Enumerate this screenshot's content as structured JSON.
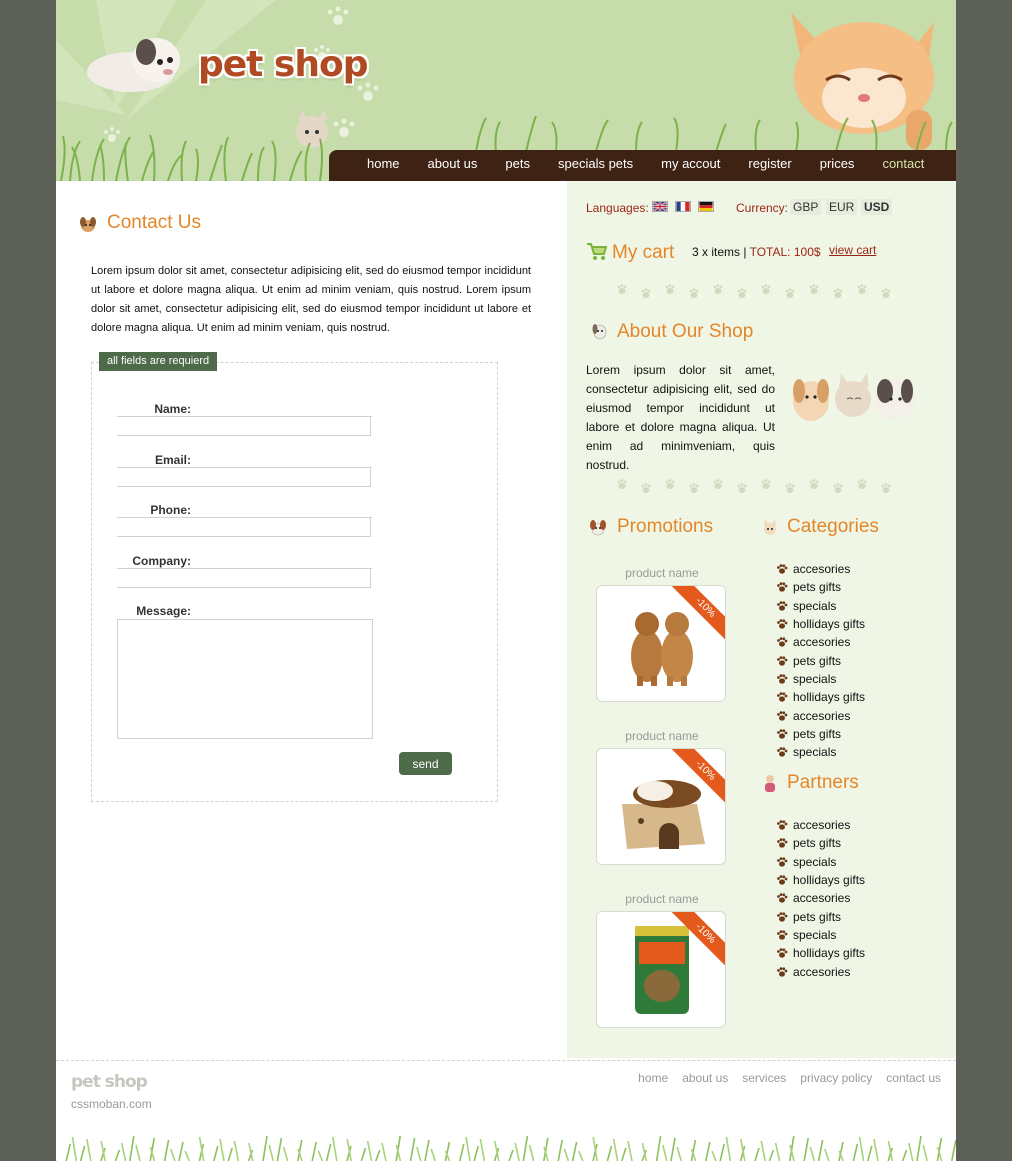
{
  "brand": {
    "logo": "pet shop",
    "footer_logo": "pet shop",
    "footer_site": "cssmoban.com"
  },
  "nav": {
    "items": [
      "home",
      "about us",
      "pets",
      "specials pets",
      "my accout",
      "register",
      "prices",
      "contact"
    ],
    "active": "contact"
  },
  "contact": {
    "title": "Contact Us",
    "intro": "Lorem ipsum dolor sit amet, consectetur adipisicing elit, sed do eiusmod tempor incididunt ut labore et dolore magna aliqua. Ut enim ad minim veniam, quis nostrud. Lorem ipsum dolor sit amet, consectetur adipisicing elit, sed do eiusmod tempor incididunt ut labore et dolore magna aliqua. Ut enim ad minim veniam, quis nostrud.",
    "legend": "all fields are requierd",
    "labels": {
      "name": "Name:",
      "email": "Email:",
      "phone": "Phone:",
      "company": "Company:",
      "message": "Message:"
    },
    "send_label": "send"
  },
  "sidebar": {
    "languages_label": "Languages:",
    "currency_label": "Currency:",
    "currencies": [
      "GBP",
      "EUR",
      "USD"
    ],
    "selected_currency": "USD",
    "cart": {
      "title": "My cart",
      "items": "3 x items",
      "separator": "|",
      "total": "TOTAL: 100$",
      "view": "view cart"
    },
    "about": {
      "title": "About Our Shop",
      "text": "Lorem ipsum dolor sit amet, consectetur adipisicing elit, sed do eiusmod tempor incididunt ut labore et dolore magna aliqua. Ut enim ad minimveniam, quis nostrud."
    },
    "promotions": {
      "title": "Promotions",
      "products": [
        {
          "name": "product name",
          "discount": "-10%"
        },
        {
          "name": "product name",
          "discount": "-10%"
        },
        {
          "name": "product name",
          "discount": "-10%"
        }
      ]
    },
    "categories": {
      "title": "Categories",
      "items": [
        "accesories",
        "pets gifts",
        "specials",
        "hollidays gifts",
        "accesories",
        "pets gifts",
        "specials",
        "hollidays gifts",
        "accesories",
        "pets gifts",
        "specials"
      ]
    },
    "partners": {
      "title": "Partners",
      "items": [
        "accesories",
        "pets gifts",
        "specials",
        "hollidays gifts",
        "accesories",
        "pets gifts",
        "specials",
        "hollidays gifts",
        "accesories"
      ]
    }
  },
  "footer": {
    "links": [
      "home",
      "about us",
      "services",
      "privacy policy",
      "contact us"
    ]
  },
  "colors": {
    "accent": "#e4862a",
    "nav_bg": "#3e2314",
    "header_bg": "#c6dcaa",
    "sidebar_bg": "#f0f6e5",
    "button": "#4d6a49",
    "link": "#9b2515"
  }
}
